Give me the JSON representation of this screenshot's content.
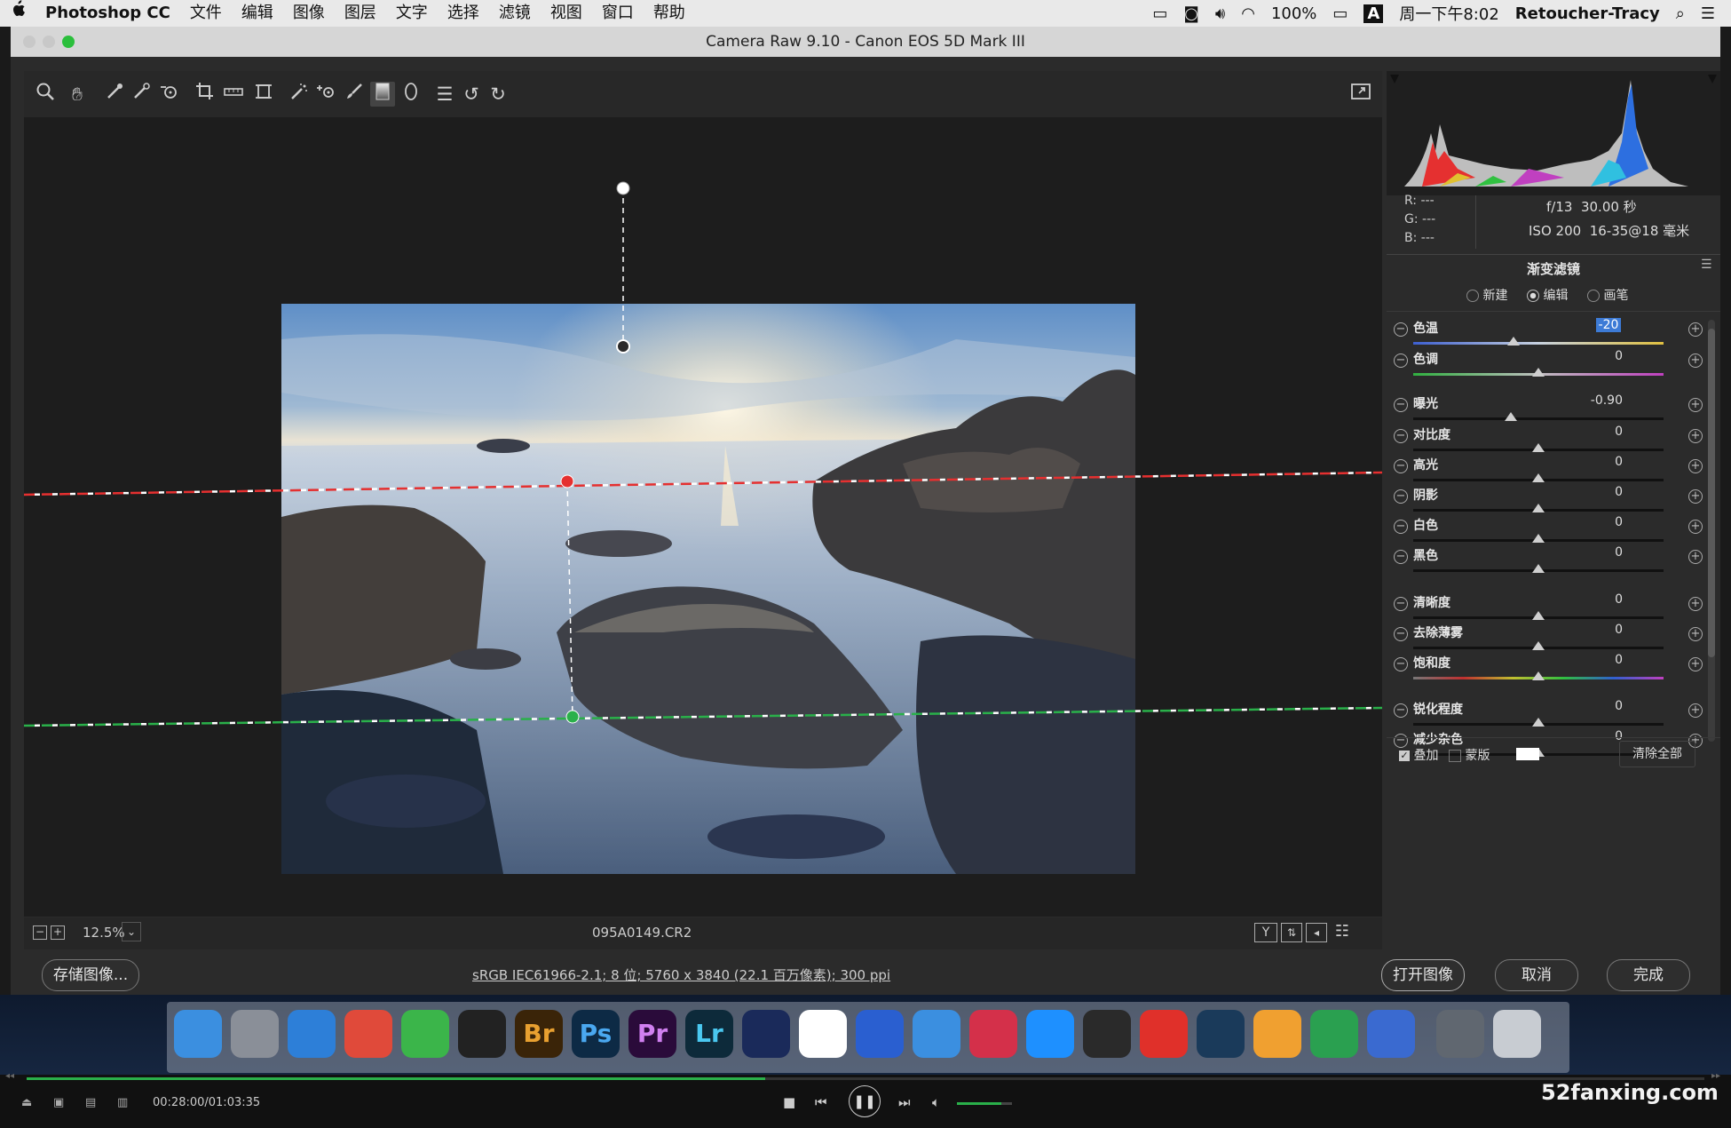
{
  "menubar": {
    "apple": "",
    "app_name": "Photoshop CC",
    "items": [
      "文件",
      "编辑",
      "图像",
      "图层",
      "文字",
      "选择",
      "滤镜",
      "视图",
      "窗口",
      "帮助"
    ],
    "battery": "100%",
    "input_method": "A",
    "clock": "周一下午8:02",
    "user": "Retoucher-Tracy"
  },
  "window": {
    "title": "Camera Raw 9.10 -  Canon EOS 5D Mark III"
  },
  "toolbar": {
    "tools": [
      "zoom-tool-icon",
      "hand-tool-icon",
      "white-balance-tool-icon",
      "color-sampler-tool-icon",
      "targeted-adjustment-tool-icon",
      "crop-tool-icon",
      "straighten-tool-icon",
      "transform-tool-icon",
      "spot-removal-tool-icon",
      "red-eye-tool-icon",
      "adjustment-brush-icon",
      "graduated-filter-icon",
      "radial-filter-icon",
      "preferences-icon",
      "rotate-left-icon",
      "rotate-right-icon"
    ],
    "fullscreen_icon": "fullscreen-icon"
  },
  "status": {
    "zoom": "12.5%",
    "filename": "095A0149.CR2"
  },
  "info": {
    "r_label": "R:",
    "r_value": "---",
    "g_label": "G:",
    "g_value": "---",
    "b_label": "B:",
    "b_value": "---",
    "aperture": "f/13",
    "shutter": "30.00 秒",
    "iso": "ISO 200",
    "lens": "16-35@18 毫米"
  },
  "panel": {
    "title": "渐变滤镜",
    "mode_new": "新建",
    "mode_edit": "编辑",
    "mode_brush": "画笔",
    "mode_selected": "编辑",
    "sliders": [
      {
        "label": "色温",
        "value": "-20",
        "pos": 0.4
      },
      {
        "label": "色调",
        "value": "0",
        "pos": 0.5
      },
      {
        "label": "曝光",
        "value": "-0.90",
        "pos": 0.39
      },
      {
        "label": "对比度",
        "value": "0",
        "pos": 0.5
      },
      {
        "label": "高光",
        "value": "0",
        "pos": 0.5
      },
      {
        "label": "阴影",
        "value": "0",
        "pos": 0.5
      },
      {
        "label": "白色",
        "value": "0",
        "pos": 0.5
      },
      {
        "label": "黑色",
        "value": "0",
        "pos": 0.5
      },
      {
        "label": "清晰度",
        "value": "0",
        "pos": 0.5
      },
      {
        "label": "去除薄雾",
        "value": "0",
        "pos": 0.5
      },
      {
        "label": "饱和度",
        "value": "0",
        "pos": 0.5
      },
      {
        "label": "锐化程度",
        "value": "0",
        "pos": 0.5
      },
      {
        "label": "减少杂色",
        "value": "0",
        "pos": 0.5
      }
    ],
    "overlay_label": "叠加",
    "overlay_checked": true,
    "mask_label": "蒙版",
    "mask_checked": false,
    "clear_all": "清除全部"
  },
  "bottom": {
    "save_image": "存储图像...",
    "workflow_info": "sRGB IEC61966-2.1; 8 位;  5760 x 3840 (22.1 百万像素); 300 ppi",
    "open_image": "打开图像",
    "cancel": "取消",
    "done": "完成"
  },
  "dock": {
    "apps": [
      {
        "name": "finder",
        "label": "",
        "color": "#3b8fe0"
      },
      {
        "name": "launchpad",
        "label": "",
        "color": "#8a8f98"
      },
      {
        "name": "safari",
        "label": "",
        "color": "#2d7fd8"
      },
      {
        "name": "chrome",
        "label": "",
        "color": "#e04a3a"
      },
      {
        "name": "wechat",
        "label": "",
        "color": "#3bb54a"
      },
      {
        "name": "qq",
        "label": "",
        "color": "#222222"
      },
      {
        "name": "bridge",
        "label": "Br",
        "color": "#3a2408"
      },
      {
        "name": "photoshop",
        "label": "Ps",
        "color": "#0d2a45"
      },
      {
        "name": "premiere",
        "label": "Pr",
        "color": "#2a0b3a"
      },
      {
        "name": "lightroom",
        "label": "Lr",
        "color": "#0d2a3a"
      },
      {
        "name": "cinema4d",
        "label": "",
        "color": "#1a2a5a"
      },
      {
        "name": "baidu-netdisk",
        "label": "",
        "color": "#ffffff"
      },
      {
        "name": "screen-recorder",
        "label": "",
        "color": "#2a5fd0"
      },
      {
        "name": "1password",
        "label": "",
        "color": "#3b8fe0"
      },
      {
        "name": "davinci",
        "label": "",
        "color": "#d4304a"
      },
      {
        "name": "infuse",
        "label": "",
        "color": "#1e90ff"
      },
      {
        "name": "obs",
        "label": "",
        "color": "#2a2a2a"
      },
      {
        "name": "netease-music",
        "label": "",
        "color": "#e0302a"
      },
      {
        "name": "quicktime",
        "label": "",
        "color": "#1a3a5a"
      },
      {
        "name": "pages",
        "label": "",
        "color": "#f0a030"
      },
      {
        "name": "numbers",
        "label": "",
        "color": "#2aa050"
      },
      {
        "name": "keynote",
        "label": "",
        "color": "#3a6ad0"
      },
      {
        "name": "screen-sharing",
        "label": "",
        "color": "#606770"
      },
      {
        "name": "trash",
        "label": "",
        "color": "#c8ccd2"
      }
    ]
  },
  "video": {
    "time": "00:28:00/01:03:35",
    "watermark": "52fanxing.com",
    "progress": 0.44,
    "volume": 0.8
  },
  "colors": {
    "accent_blue": "#3d7bd6",
    "pin_red": "#e53030",
    "pin_green": "#2ab04a"
  }
}
